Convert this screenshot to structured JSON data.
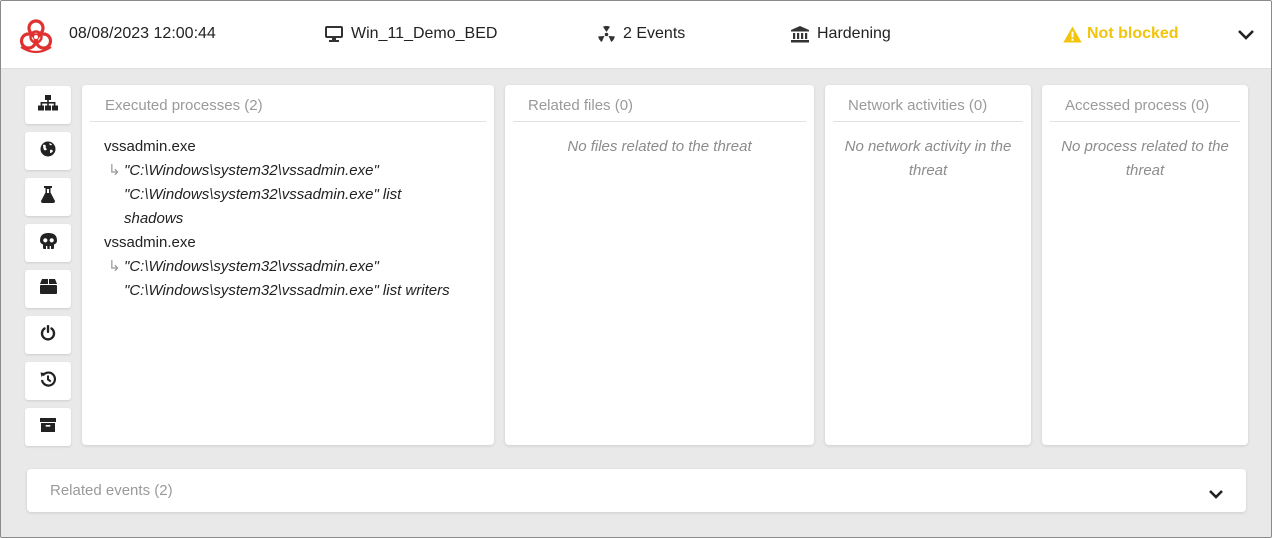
{
  "header": {
    "datetime": "08/08/2023 12:00:44",
    "host": "Win_11_Demo_BED",
    "events": "2 Events",
    "policy": "Hardening",
    "status": "Not blocked",
    "status_color": "#f2c40c",
    "threat_icon_color": "#e03131"
  },
  "sidebar": {
    "items": [
      {
        "name": "process-tree-icon"
      },
      {
        "name": "network-globe-icon"
      },
      {
        "name": "flask-icon"
      },
      {
        "name": "skull-icon"
      },
      {
        "name": "package-icon"
      },
      {
        "name": "power-icon"
      },
      {
        "name": "history-icon"
      },
      {
        "name": "archive-icon"
      }
    ]
  },
  "panels": {
    "executed": {
      "title": "Executed processes (2)",
      "items": [
        {
          "name": "vssadmin.exe",
          "cmd": "\"C:\\Windows\\system32\\vssadmin.exe\" \"C:\\Windows\\system32\\vssadmin.exe\" list shadows"
        },
        {
          "name": "vssadmin.exe",
          "cmd": "\"C:\\Windows\\system32\\vssadmin.exe\" \"C:\\Windows\\system32\\vssadmin.exe\" list writers"
        }
      ]
    },
    "files": {
      "title": "Related files (0)",
      "empty": "No files related to the threat"
    },
    "network": {
      "title": "Network activities (0)",
      "empty": "No network activity in the threat"
    },
    "accessed": {
      "title": "Accessed process (0)",
      "empty": "No process related to the threat"
    }
  },
  "related_events": {
    "title": "Related events (2)"
  }
}
